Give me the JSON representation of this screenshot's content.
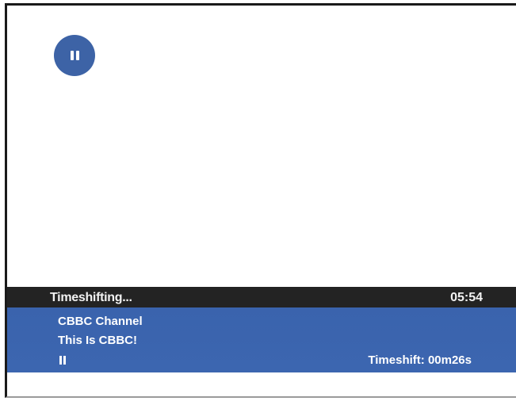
{
  "overlay": {
    "pause_icon": "pause-icon",
    "accent_color": "#3d63a6"
  },
  "status_bar": {
    "title": "Timeshifting...",
    "time": "05:54",
    "background": "#232323"
  },
  "info_panel": {
    "channel": "CBBC Channel",
    "programme": "This Is CBBC!",
    "playback_state_icon": "pause-icon",
    "timeshift": "Timeshift: 00m26s",
    "background": "#3c66b0"
  }
}
